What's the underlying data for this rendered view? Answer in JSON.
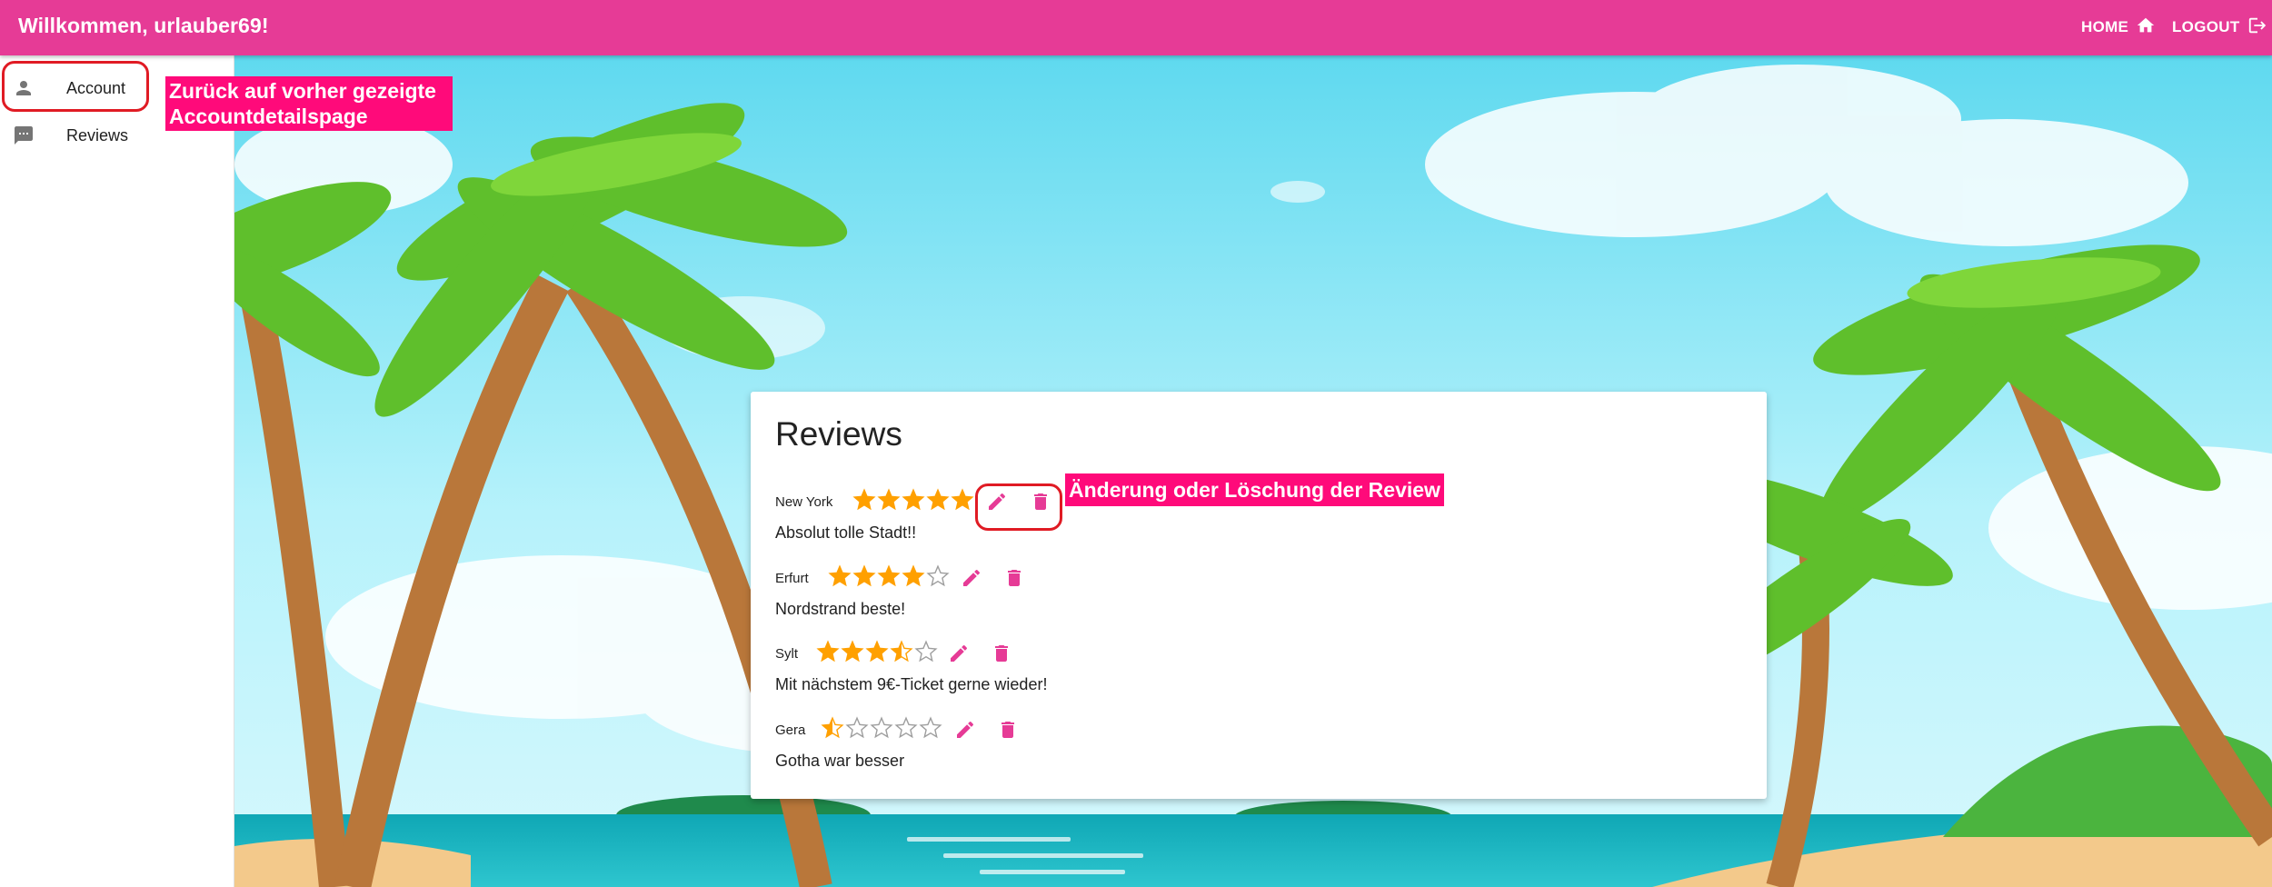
{
  "header": {
    "welcome": "Willkommen, urlauber69!",
    "home_label": "HOME",
    "logout_label": "LOGOUT"
  },
  "sidebar": {
    "items": [
      {
        "label": "Account",
        "icon": "person-icon"
      },
      {
        "label": "Reviews",
        "icon": "comment-icon"
      }
    ]
  },
  "annotations": {
    "account": "Zurück auf vorher gezeigte Accountdetailspage",
    "review_actions": "Änderung oder Löschung der Review"
  },
  "card": {
    "title": "Reviews",
    "reviews": [
      {
        "city": "New York",
        "rating": 5,
        "comment": "Absolut tolle Stadt!!"
      },
      {
        "city": "Erfurt",
        "rating": 4,
        "comment": "Nordstrand beste!"
      },
      {
        "city": "Sylt",
        "rating": 3.5,
        "comment": "Mit nächstem 9€-Ticket gerne wieder!"
      },
      {
        "city": "Gera",
        "rating": 0.5,
        "comment": "Gotha war besser"
      }
    ]
  },
  "colors": {
    "primary": "#e63b96",
    "star": "#ffa000",
    "annotation_bg": "#ff0a7a",
    "annotation_ring": "#e01b24"
  }
}
